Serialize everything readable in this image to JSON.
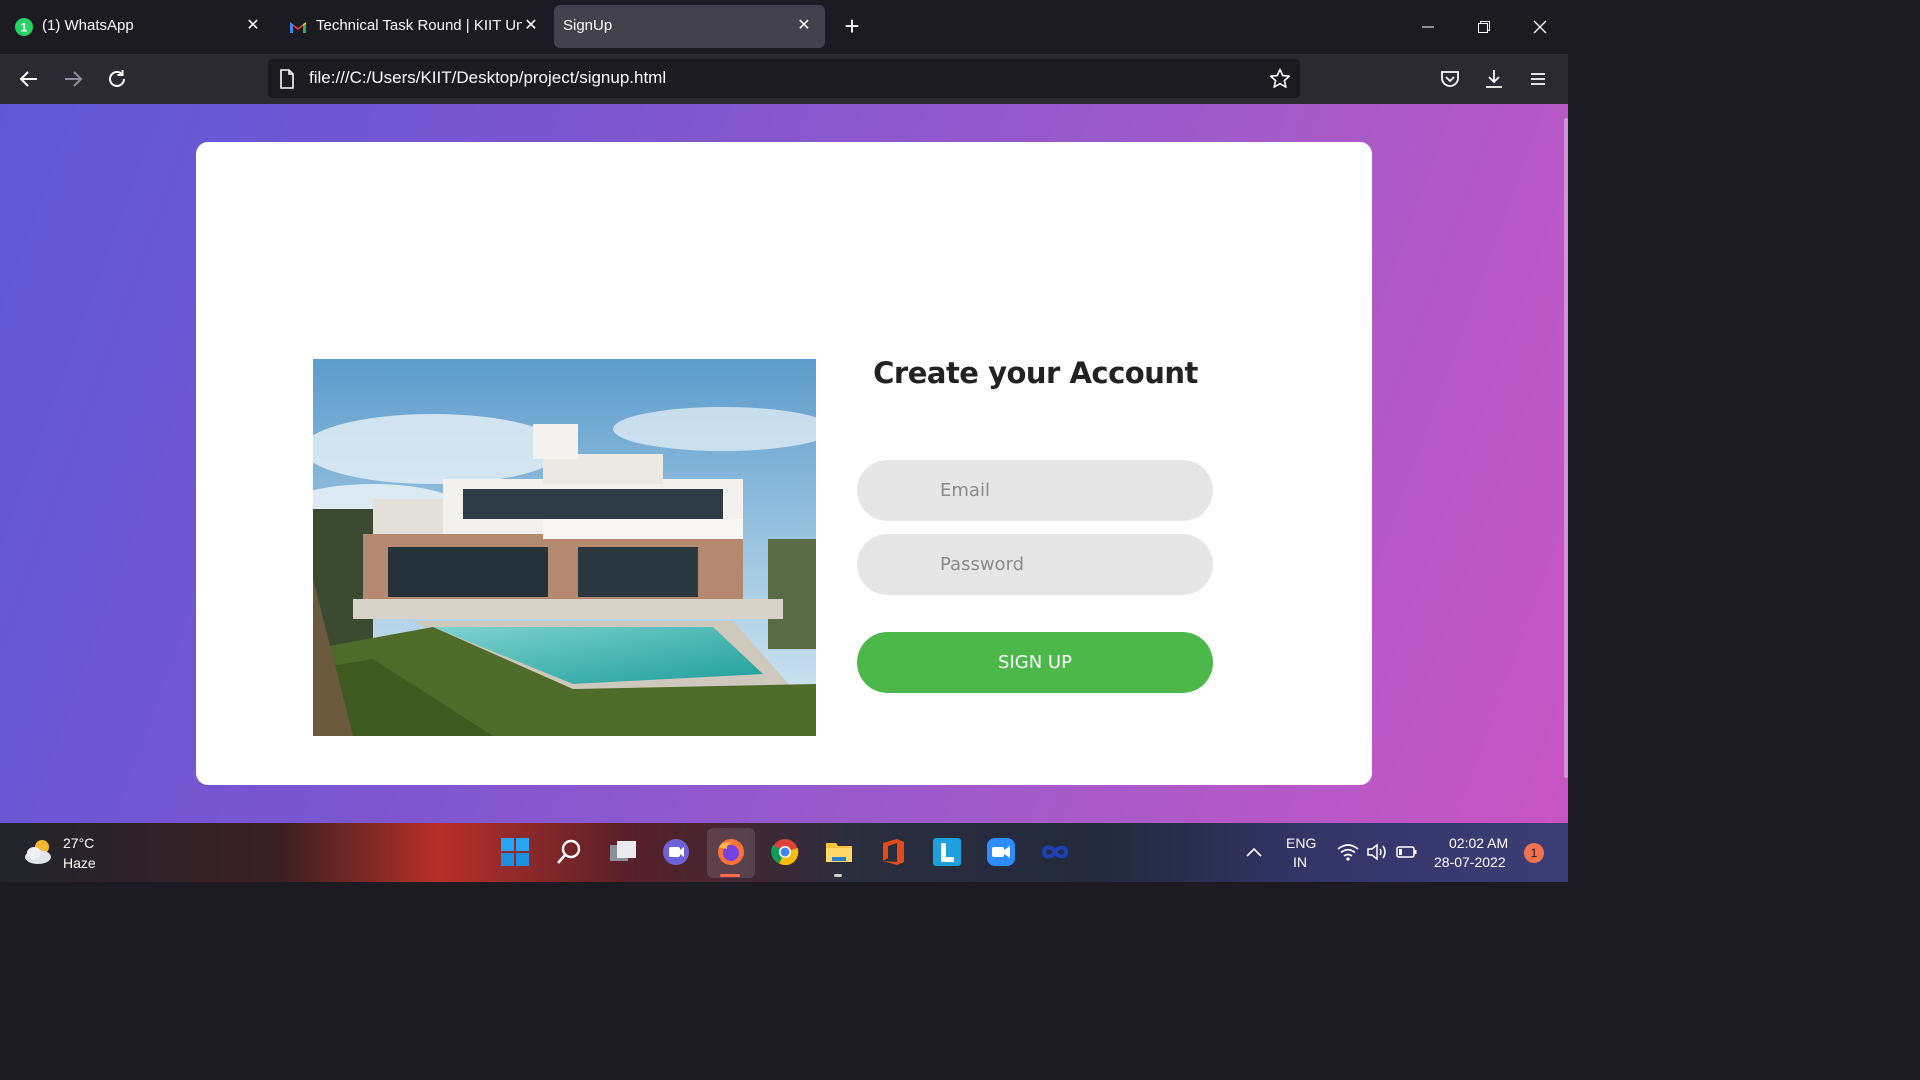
{
  "browser": {
    "tabs": [
      {
        "label": "(1) WhatsApp",
        "icon": "whatsapp-icon"
      },
      {
        "label": "Technical Task Round | KIIT Univ",
        "icon": "gmail-icon"
      },
      {
        "label": "SignUp",
        "icon": "none",
        "active": true
      }
    ],
    "url": "file:///C:/Users/KIIT/Desktop/project/signup.html"
  },
  "signup": {
    "title": "Create your Account",
    "email_placeholder": "Email",
    "password_placeholder": "Password",
    "button_label": "SIGN UP",
    "accent_color": "#4cb84a"
  },
  "taskbar": {
    "weather_temp": "27°C",
    "weather_desc": "Haze",
    "lang_top": "ENG",
    "lang_bottom": "IN",
    "time": "02:02 AM",
    "date": "28-07-2022",
    "notification_count": "1"
  }
}
